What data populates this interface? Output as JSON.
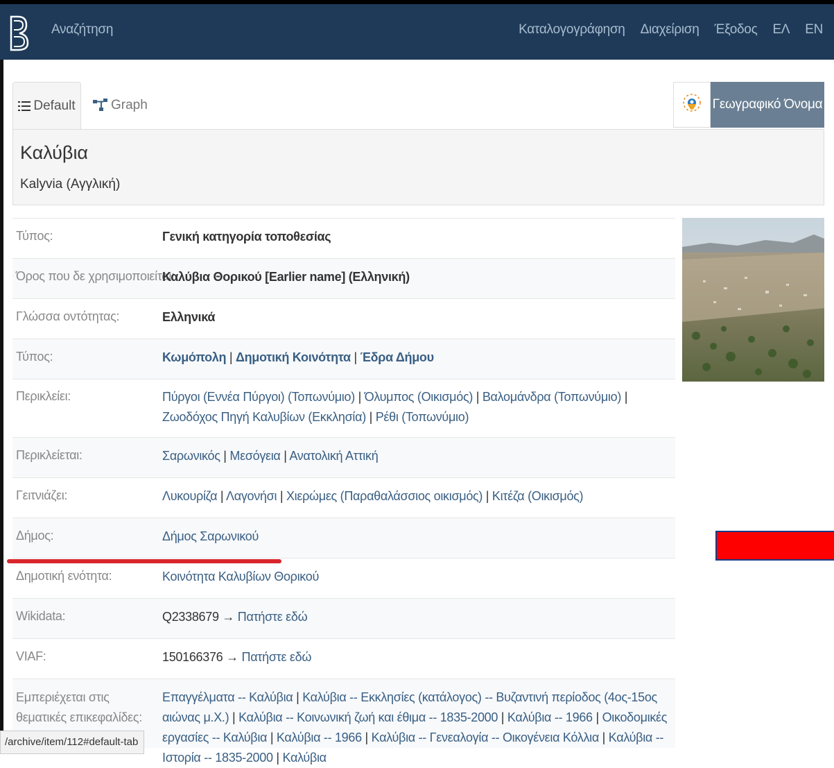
{
  "nav": {
    "search": "Αναζήτηση",
    "right": [
      "Καταλογογράφηση",
      "Διαχείριση",
      "Έξοδος",
      "ΕΛ",
      "EN"
    ]
  },
  "tabs": {
    "default": "Default",
    "graph": "Graph"
  },
  "type_badge": "Γεωγραφικό Όνομα",
  "title": {
    "main": "Καλύβια",
    "sub": "Kalyvia (Αγγλική)"
  },
  "properties": [
    {
      "label": "Τύπος:",
      "values": [
        {
          "t": "Γενική κατηγορία τοποθεσίας",
          "s": "bold"
        }
      ]
    },
    {
      "label": "Όρος που δε χρησιμοποιείται:",
      "values": [
        {
          "t": "Καλύβια Θορικού [Earlier name] (Ελληνική)",
          "s": "bold"
        }
      ]
    },
    {
      "label": "Γλώσσα οντότητας:",
      "values": [
        {
          "t": "Ελληνικά",
          "s": "bold"
        }
      ]
    },
    {
      "label": "Τύπος:",
      "values": [
        {
          "t": "Κωμόπολη",
          "s": "linkb"
        },
        {
          "t": " | ",
          "s": "plain"
        },
        {
          "t": "Δημοτική Κοινότητα",
          "s": "linkb"
        },
        {
          "t": " | ",
          "s": "plain"
        },
        {
          "t": "Έδρα Δήμου",
          "s": "linkb"
        }
      ]
    },
    {
      "label": "Περικλείει:",
      "values": [
        {
          "t": "Πύργοι (Εννέα Πύργοι) (Τοπωνύμιο)",
          "s": "link"
        },
        {
          "t": " | ",
          "s": "plain"
        },
        {
          "t": "Όλυμπος (Οικισμός)",
          "s": "link"
        },
        {
          "t": " | ",
          "s": "plain"
        },
        {
          "t": "Βαλομάνδρα (Τοπωνύμιο)",
          "s": "link"
        },
        {
          "t": " | ",
          "s": "plain"
        },
        {
          "t": "Ζωοδόχος Πηγή Καλυβίων (Εκκλησία)",
          "s": "link"
        },
        {
          "t": " | ",
          "s": "plain"
        },
        {
          "t": "Ρέθι (Τοπωνύμιο)",
          "s": "link"
        }
      ]
    },
    {
      "label": "Περικλείεται:",
      "values": [
        {
          "t": "Σαρωνικός",
          "s": "link"
        },
        {
          "t": " | ",
          "s": "plain"
        },
        {
          "t": "Μεσόγεια",
          "s": "link"
        },
        {
          "t": " | ",
          "s": "plain"
        },
        {
          "t": "Ανατολική Αττική",
          "s": "link"
        }
      ]
    },
    {
      "label": "Γειτνιάζει:",
      "values": [
        {
          "t": "Λυκουρίζα",
          "s": "link"
        },
        {
          "t": " | ",
          "s": "plain"
        },
        {
          "t": "Λαγονήσι",
          "s": "link"
        },
        {
          "t": " | ",
          "s": "plain"
        },
        {
          "t": "Χιερώμες (Παραθαλάσσιος οικισμός)",
          "s": "link"
        },
        {
          "t": " | ",
          "s": "plain"
        },
        {
          "t": "Κιτέζα (Οικισμός)",
          "s": "link"
        }
      ]
    },
    {
      "label": "Δήμος:",
      "values": [
        {
          "t": "Δήμος Σαρωνικού",
          "s": "link"
        }
      ]
    },
    {
      "label": "Δημοτική ενότητα:",
      "values": [
        {
          "t": "Κοινότητα Καλυβίων Θορικού",
          "s": "link"
        }
      ]
    },
    {
      "label": "Wikidata:",
      "values": [
        {
          "t": "Q2338679 → ",
          "s": "plain"
        },
        {
          "t": "Πατήστε εδώ",
          "s": "link"
        }
      ]
    },
    {
      "label": "VIAF:",
      "values": [
        {
          "t": "150166376 → ",
          "s": "plain"
        },
        {
          "t": "Πατήστε εδώ",
          "s": "link"
        }
      ]
    },
    {
      "label": "Εμπεριέχεται στις θεματικές επικεφαλίδες:",
      "values": [
        {
          "t": "Επαγγέλματα -- Καλύβια",
          "s": "link"
        },
        {
          "t": " | ",
          "s": "plain"
        },
        {
          "t": "Καλύβια -- Εκκλησίες (κατάλογος) -- Βυζαντινή περίοδος (4ος-15ος αιώνας μ.Χ.)",
          "s": "link"
        },
        {
          "t": " | ",
          "s": "plain"
        },
        {
          "t": "Καλύβια -- Κοινωνική ζωή και έθιμα -- 1835-2000",
          "s": "link"
        },
        {
          "t": " | ",
          "s": "plain"
        },
        {
          "t": "Καλύβια -- 1966",
          "s": "link"
        },
        {
          "t": " | ",
          "s": "plain"
        },
        {
          "t": "Οικοδομικές εργασίες -- Καλύβια",
          "s": "link"
        },
        {
          "t": " | ",
          "s": "plain"
        },
        {
          "t": "Καλύβια -- 1966",
          "s": "link"
        },
        {
          "t": " | ",
          "s": "plain"
        },
        {
          "t": "Καλύβια -- Γενεαλογία -- Οικογένεια Κόλλια",
          "s": "link"
        },
        {
          "t": " | ",
          "s": "plain"
        },
        {
          "t": "Καλύβια -- Ιστορία -- 1835-2000",
          "s": "link"
        },
        {
          "t": " | ",
          "s": "plain"
        },
        {
          "t": "Καλύβια",
          "s": "link"
        }
      ]
    }
  ],
  "status_url": "/archive/item/112#default-tab",
  "colors": {
    "navbar": "#1e3a58",
    "badge": "#6a7f93",
    "link": "#3a5f83",
    "highlight": "#ff0000"
  }
}
